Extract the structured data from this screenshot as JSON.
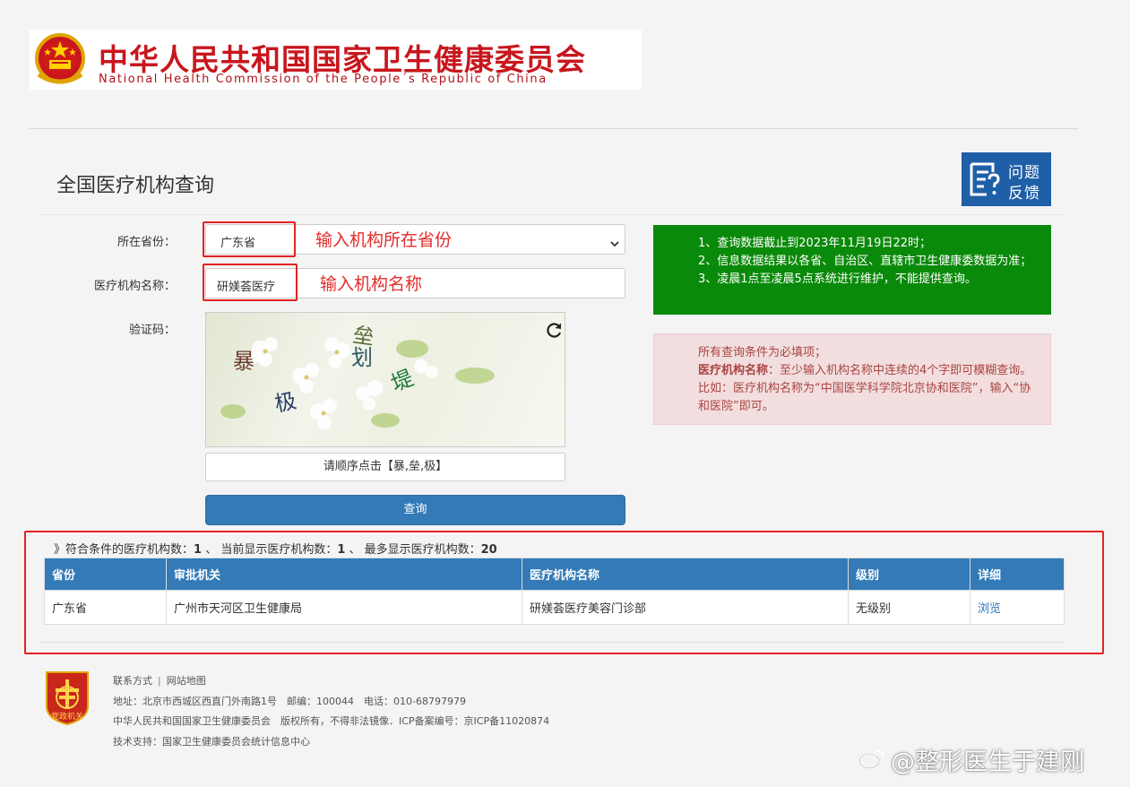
{
  "header": {
    "title_cn": "中华人民共和国国家卫生健康委员会",
    "title_en": "National Health Commission of the People´s Republic of China"
  },
  "page": {
    "title": "全国医疗机构查询",
    "feedback_line1": "问题",
    "feedback_line2": "反馈"
  },
  "form": {
    "province_label": "所在省份：",
    "province_value": "广东省",
    "org_label": "医疗机构名称：",
    "org_value": "研媄荟医疗",
    "captcha_label": "验证码：",
    "captcha_chars": [
      "暴",
      "垒",
      "划",
      "堤",
      "极"
    ],
    "captcha_hint": "请顺序点击【暴,垒,极】",
    "query_button": "查询"
  },
  "annotations": {
    "province_note": "输入机构所在省份",
    "org_note": "输入机构名称"
  },
  "info_green": {
    "line1": "1、查询数据截止到2023年11月19日22时；",
    "line2": "2、信息数据结果以各省、自治区、直辖市卫生健康委数据为准；",
    "line3": "3、凌晨1点至凌晨5点系统进行维护，不能提供查询。"
  },
  "info_red": {
    "line1": "所有查询条件为必填项；",
    "bold_label": "医疗机构名称",
    "line2": "：至少输入机构名称中连续的4个字即可模糊查询。比如：医疗机构名称为“中国医学科学院北京协和医院”，输入“协和医院”即可。"
  },
  "results": {
    "summary_prefix": "》符合条件的医疗机构数：",
    "match_count": "1",
    "summary_mid": " 、 当前显示医疗机构数：",
    "shown_count": "1",
    "summary_mid2": " 、 最多显示医疗机构数：",
    "max_count": "20",
    "columns": [
      "省份",
      "审批机关",
      "医疗机构名称",
      "级别",
      "详细"
    ],
    "rows": [
      {
        "province": "广东省",
        "authority": "广州市天河区卫生健康局",
        "name": "研媄荟医疗美容门诊部",
        "level": "无级别",
        "detail": "浏览"
      }
    ]
  },
  "footer": {
    "link_contact": "联系方式",
    "link_separator": "|",
    "link_sitemap": "网站地图",
    "address": "地址：北京市西城区西直门外南路1号　邮编：100044　电话：010-68797979",
    "copyright": "中华人民共和国国家卫生健康委员会　版权所有，不得非法镜像．ICP备案编号：京ICP备11020874",
    "support": "技术支持：国家卫生健康委员会统计信息中心",
    "logo_text": "党政机关"
  },
  "watermark": "@整形医生于建刚",
  "colors": {
    "brand_red": "#c8161d",
    "primary_blue": "#337ab7",
    "info_green": "#0a8a0a",
    "alert_bg": "#f2dede",
    "alert_text": "#a94442",
    "annotation_red": "#e42222"
  }
}
